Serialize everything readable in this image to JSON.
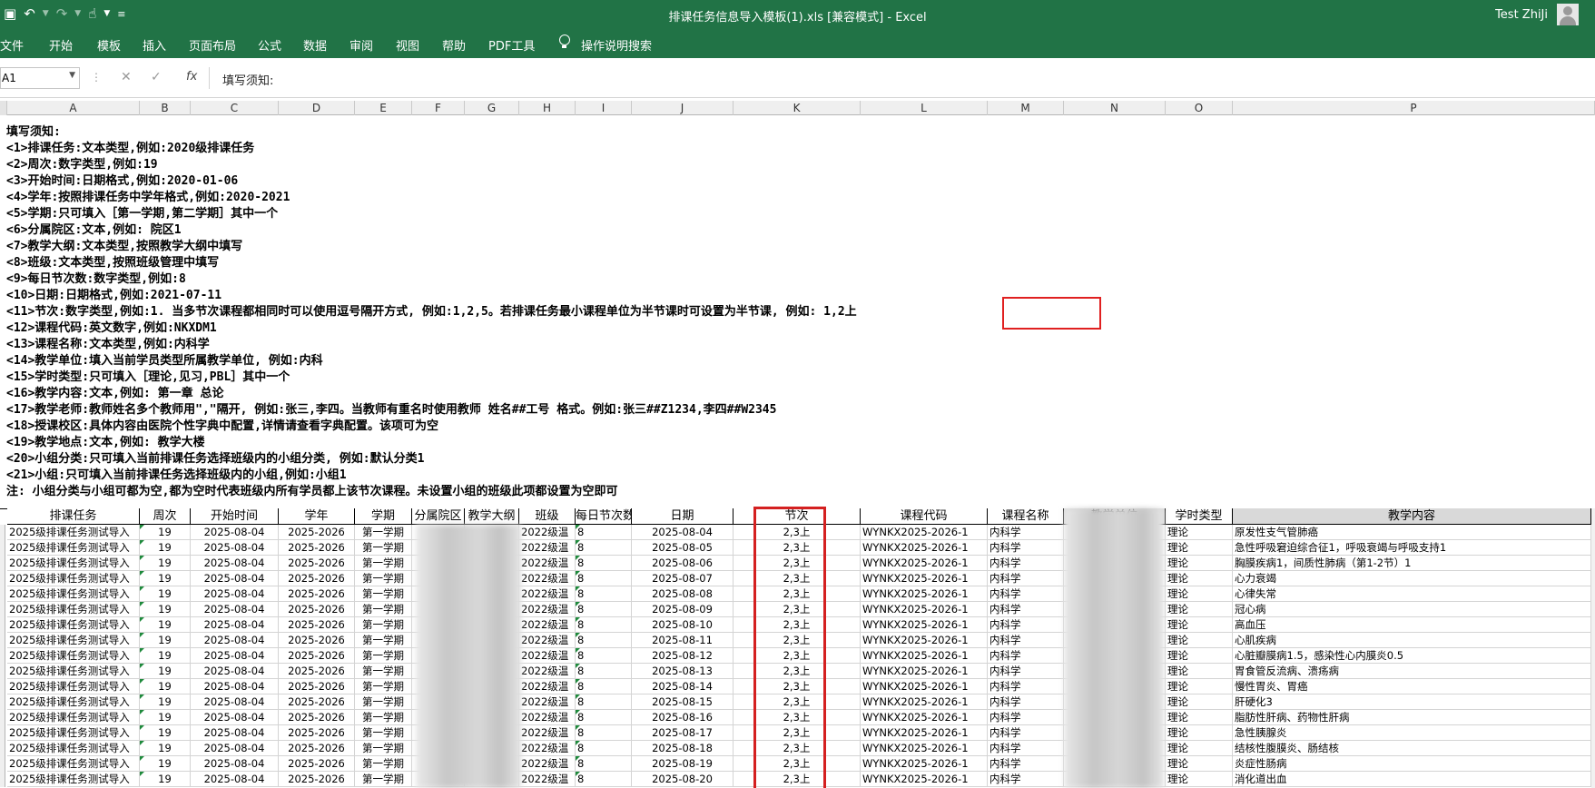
{
  "window": {
    "title": "排课任务信息导入模板(1).xls  [兼容模式]  -  Excel",
    "user_name": "Test ZhiJi"
  },
  "ribbon": {
    "tabs": [
      "文件",
      "开始",
      "模板",
      "插入",
      "页面布局",
      "公式",
      "数据",
      "审阅",
      "视图",
      "帮助",
      "PDF工具",
      "操作说明搜索"
    ]
  },
  "formula_bar": {
    "name_box": "A1",
    "formula": "填写须知:"
  },
  "columns": [
    "A",
    "B",
    "C",
    "D",
    "E",
    "F",
    "G",
    "H",
    "I",
    "J",
    "K",
    "L",
    "M",
    "N",
    "O",
    "P"
  ],
  "notes": [
    "填写须知:",
    "<1>排课任务:文本类型,例如:2020级排课任务",
    "<2>周次:数字类型,例如:19",
    "<3>开始时间:日期格式,例如:2020-01-06",
    "<4>学年:按照排课任务中学年格式,例如:2020-2021",
    "<5>学期:只可填入［第一学期,第二学期］其中一个",
    "<6>分属院区:文本,例如: 院区1",
    "<7>教学大纲:文本类型,按照教学大纲中填写",
    "<8>班级:文本类型,按照班级管理中填写",
    "<9>每日节次数:数字类型,例如:8",
    "<10>日期:日期格式,例如:2021-07-11",
    "<11>节次:数字类型,例如:1. 当多节次课程都相同时可以使用逗号隔开方式, 例如:1,2,5。若排课任务最小课程单位为半节课时可设置为半节课, 例如: 1,2上",
    "<12>课程代码:英文数字,例如:NKXDM1",
    "<13>课程名称:文本类型,例如:内科学",
    "<14>教学单位:填入当前学员类型所属教学单位, 例如:内科",
    "<15>学时类型:只可填入［理论,见习,PBL］其中一个",
    "<16>教学内容:文本,例如: 第一章 总论",
    "<17>教学老师:教师姓名多个教师用\",\"隔开, 例如:张三,李四。当教师有重名时使用教师 姓名##工号 格式。例如:张三##Z1234,李四##W2345",
    "<18>授课校区:具体内容由医院个性字典中配置,详情请查看字典配置。该项可为空",
    "<19>教学地点:文本,例如: 教学大楼",
    "<20>小组分类:只可填入当前排课任务选择班级内的小组分类, 例如:默认分类1",
    "<21>小组:只可填入当前排课任务选择班级内的小组,例如:小组1",
    "注: 小组分类与小组可都为空,都为空时代表班级内所有学员都上该节次课程。未设置小组的班级此项都设置为空即可"
  ],
  "table": {
    "headers": [
      "排课任务",
      "周次",
      "开始时间",
      "学年",
      "学期",
      "分属院区",
      "教学大纲",
      "班级",
      "每日节次数",
      "日期",
      "节次",
      "课程代码",
      "课程名称",
      "教学单位",
      "学时类型",
      "教学内容"
    ],
    "common": {
      "task": "2025级排课任务测试导入",
      "week": "19",
      "start": "2025-08-04",
      "year": "2025-2026",
      "term": "第一学期",
      "class": "2022级温",
      "daily": "8",
      "section": "2,3上",
      "code": "WYNKX2025-2026-1",
      "course": "内科学",
      "type": "理论"
    },
    "rows": [
      {
        "date": "2025-08-04",
        "content": "原发性支气管肺癌"
      },
      {
        "date": "2025-08-05",
        "content": "急性呼吸窘迫综合征1，呼吸衰竭与呼吸支持1"
      },
      {
        "date": "2025-08-06",
        "content": "胸膜疾病1，间质性肺病（第1-2节）1"
      },
      {
        "date": "2025-08-07",
        "content": "心力衰竭"
      },
      {
        "date": "2025-08-08",
        "content": "心律失常"
      },
      {
        "date": "2025-08-09",
        "content": "冠心病"
      },
      {
        "date": "2025-08-10",
        "content": "高血压"
      },
      {
        "date": "2025-08-11",
        "content": "心肌疾病"
      },
      {
        "date": "2025-08-12",
        "content": "心脏瓣膜病1.5，感染性心内膜炎0.5"
      },
      {
        "date": "2025-08-13",
        "content": "胃食管反流病、溃疡病"
      },
      {
        "date": "2025-08-14",
        "content": "慢性胃炎、胃癌"
      },
      {
        "date": "2025-08-15",
        "content": "肝硬化3"
      },
      {
        "date": "2025-08-16",
        "content": "脂肪性肝病、药物性肝病"
      },
      {
        "date": "2025-08-17",
        "content": "急性胰腺炎"
      },
      {
        "date": "2025-08-18",
        "content": "结核性腹膜炎、肠结核"
      },
      {
        "date": "2025-08-19",
        "content": "炎症性肠病"
      },
      {
        "date": "2025-08-20",
        "content": "消化道出血"
      }
    ]
  },
  "colors": {
    "excel_green": "#217346",
    "highlight_red": "#e02020"
  }
}
